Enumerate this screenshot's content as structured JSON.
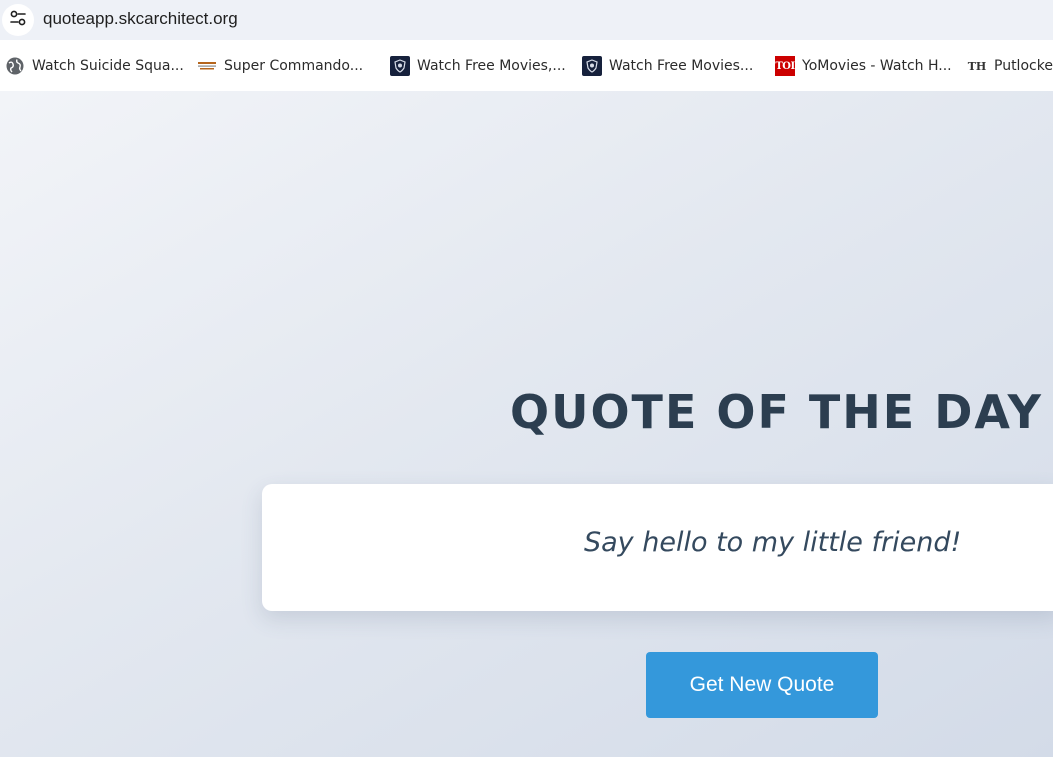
{
  "browser": {
    "address_bar": {
      "url": "quoteapp.skcarchitect.org",
      "site_info_icon": "tune-icon"
    },
    "bookmarks": [
      {
        "label": "Watch Suicide Squa...",
        "icon": "globe-icon"
      },
      {
        "label": "Super Commando...",
        "icon": "super-commando-favicon"
      },
      {
        "label": "Watch Free Movies,...",
        "icon": "shield-favicon"
      },
      {
        "label": "Watch Free Movies...",
        "icon": "shield-favicon"
      },
      {
        "label": "YoMovies - Watch H...",
        "icon": "toi-favicon",
        "icon_text": "TOI"
      },
      {
        "label": "Putlocker",
        "icon": "th-favicon",
        "icon_text": "TH"
      }
    ]
  },
  "page": {
    "title": "QUOTE OF THE DAY",
    "quote": "Say hello to my little friend!",
    "button_label": "Get New Quote"
  },
  "colors": {
    "title": "#2c3e50",
    "quote_text": "#34495e",
    "button_bg": "#3498db",
    "button_text": "#ffffff",
    "card_bg": "#ffffff",
    "address_bar_bg": "#eef1f7"
  }
}
